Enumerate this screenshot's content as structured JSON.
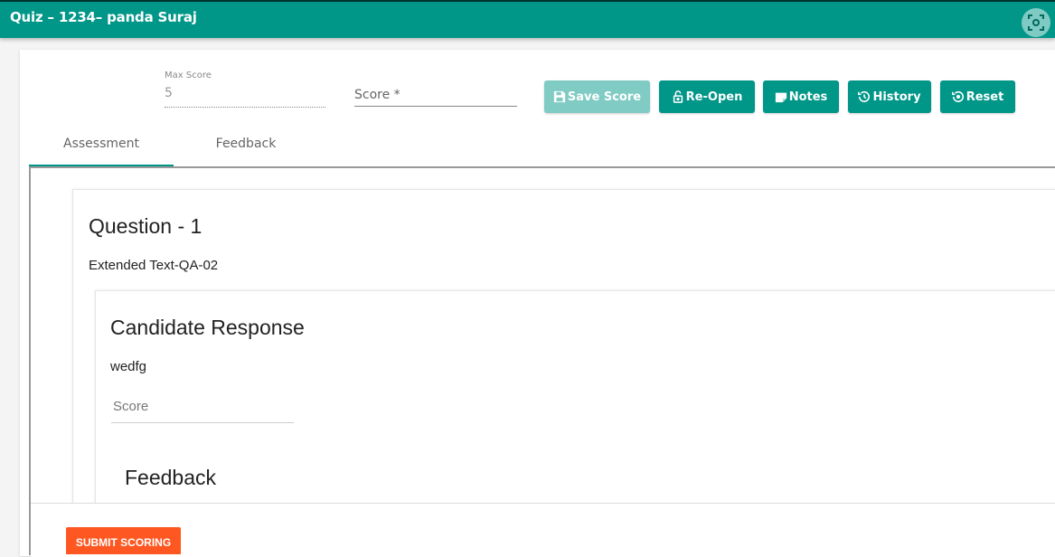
{
  "app": {
    "title": "Quiz – 1234– panda Suraj"
  },
  "score_bar": {
    "max_score_label": "Max Score",
    "max_score_value": "5",
    "score_placeholder": "Score *"
  },
  "toolbar": {
    "save_score": "Save Score",
    "reopen": "Re-Open",
    "notes": "Notes",
    "history": "History",
    "reset": "Reset"
  },
  "tabs": [
    {
      "label": "Assessment",
      "active": true
    },
    {
      "label": "Feedback",
      "active": false
    }
  ],
  "question": {
    "title": "Question - 1",
    "subtitle": "Extended Text-QA-02"
  },
  "response": {
    "title": "Candidate Response",
    "text": "wedfg",
    "score_placeholder": "Score",
    "feedback_title": "Feedback"
  },
  "footer": {
    "submit": "SUBMIT SCORING"
  },
  "colors": {
    "primary": "#009688",
    "primary_disabled": "#80cbc4",
    "accent": "#ff5722"
  }
}
